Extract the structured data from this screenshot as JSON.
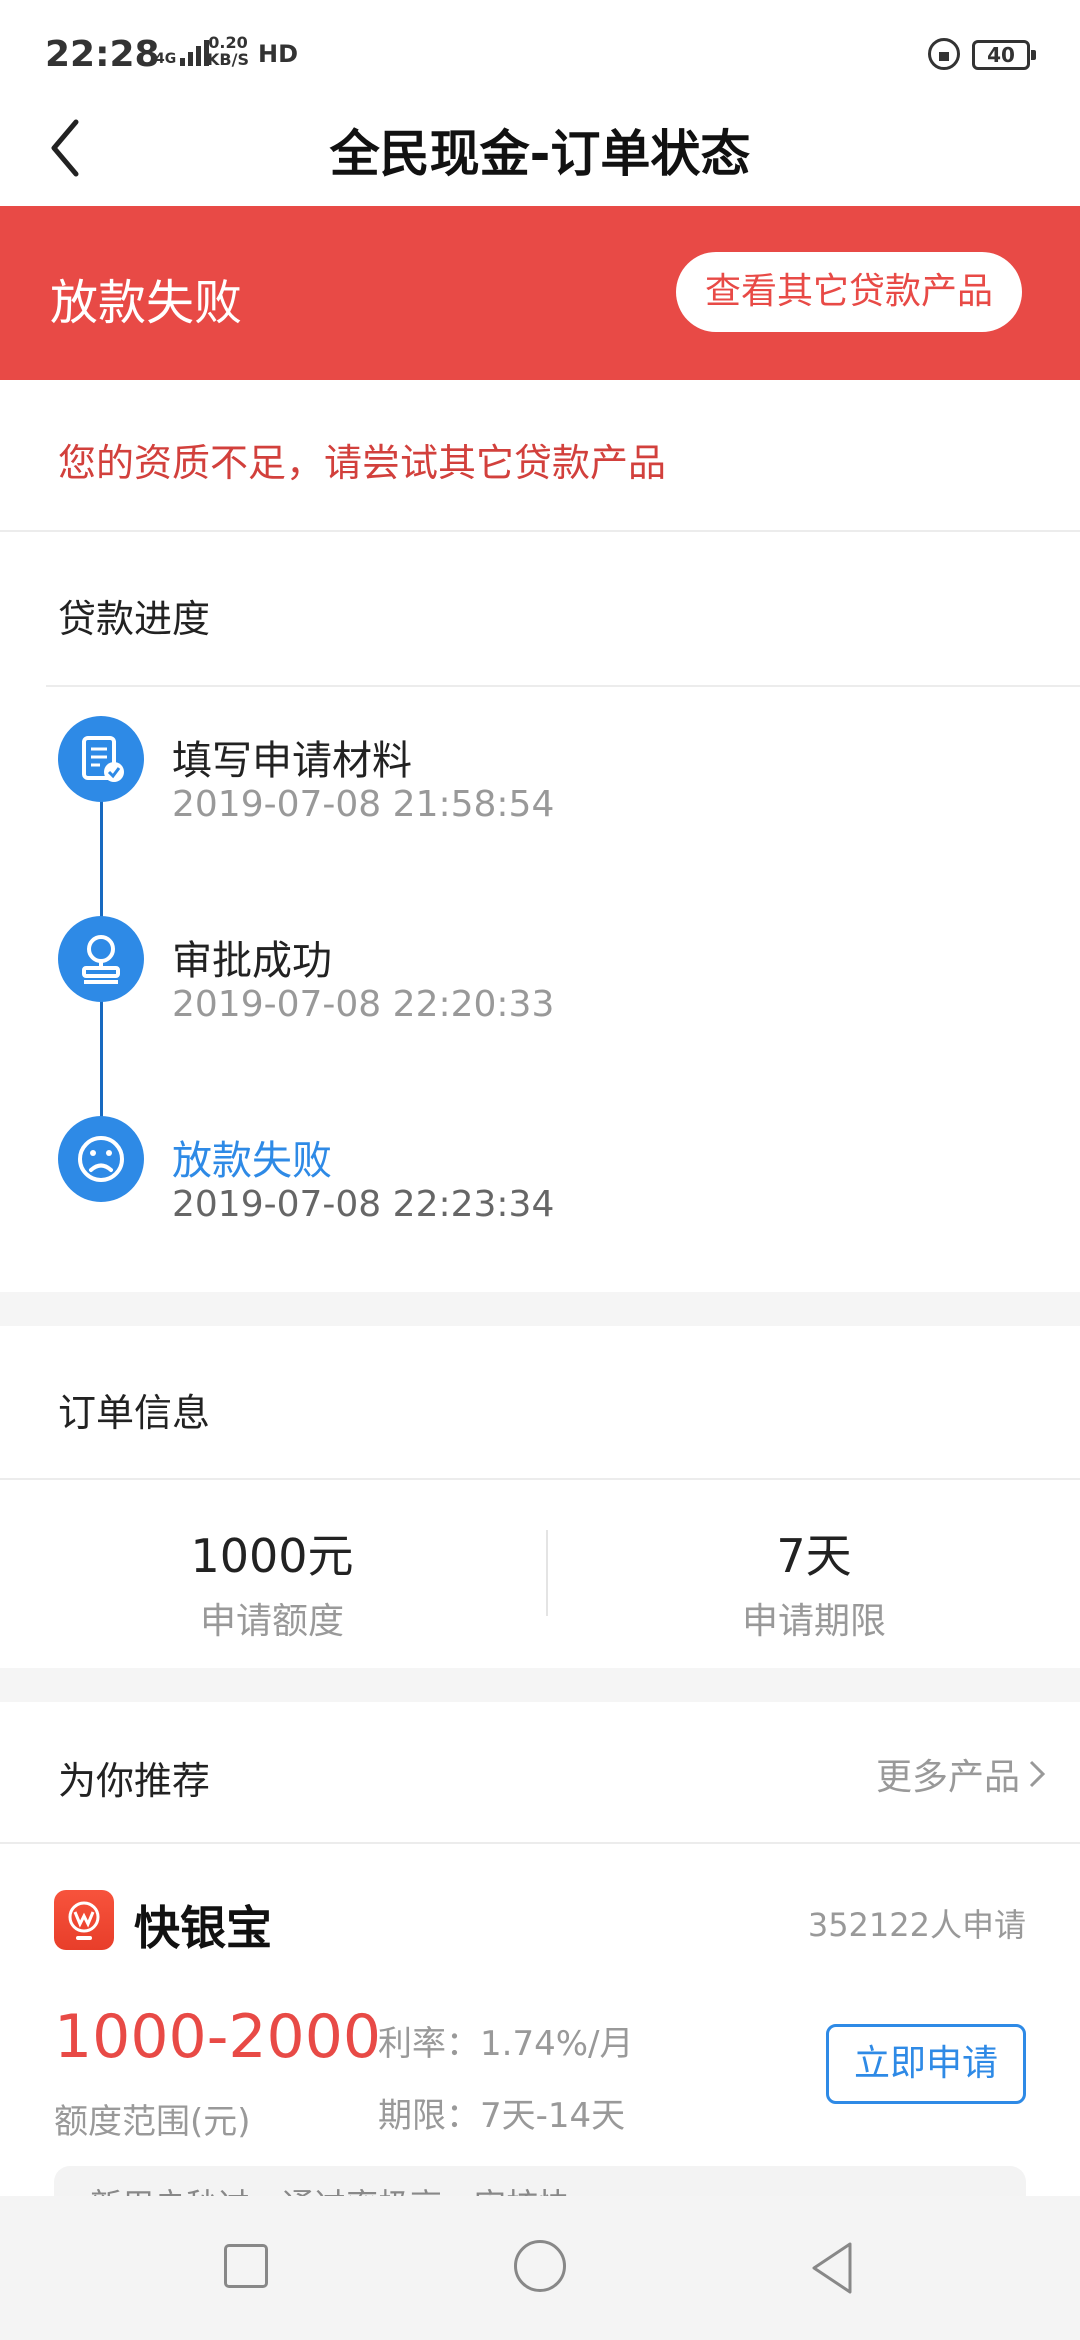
{
  "status_bar": {
    "time": "22:28",
    "network": "4G",
    "speed_top": "0.20",
    "speed_bottom": "KB/S",
    "hd": "HD",
    "battery": "40"
  },
  "header": {
    "title": "全民现金-订单状态"
  },
  "banner": {
    "status": "放款失败",
    "button_label": "查看其它贷款产品",
    "color": "#e84a46"
  },
  "notice": "您的资质不足，请尝试其它贷款产品",
  "progress": {
    "title": "贷款进度",
    "steps": [
      {
        "title": "填写申请材料",
        "time": "2019-07-08 21:58:54",
        "icon": "document-check-icon"
      },
      {
        "title": "审批成功",
        "time": "2019-07-08 22:20:33",
        "icon": "stamp-icon"
      },
      {
        "title": "放款失败",
        "time": "2019-07-08 22:23:34",
        "icon": "sad-face-icon"
      }
    ]
  },
  "order_info": {
    "title": "订单信息",
    "amount_value": "1000元",
    "amount_label": "申请额度",
    "term_value": "7天",
    "term_label": "申请期限"
  },
  "recommend": {
    "title": "为你推荐",
    "more_label": "更多产品",
    "product": {
      "name": "快银宝",
      "applicants": "352122人申请",
      "amount_range": "1000-2000",
      "amount_label": "额度范围(元)",
      "rate": "利率：1.74%/月",
      "term": "期限：7天-14天",
      "apply_label": "立即申请",
      "tagline": "新用户秒过，通过率极高，审核快"
    }
  },
  "accent_color": "#2e8ae6"
}
